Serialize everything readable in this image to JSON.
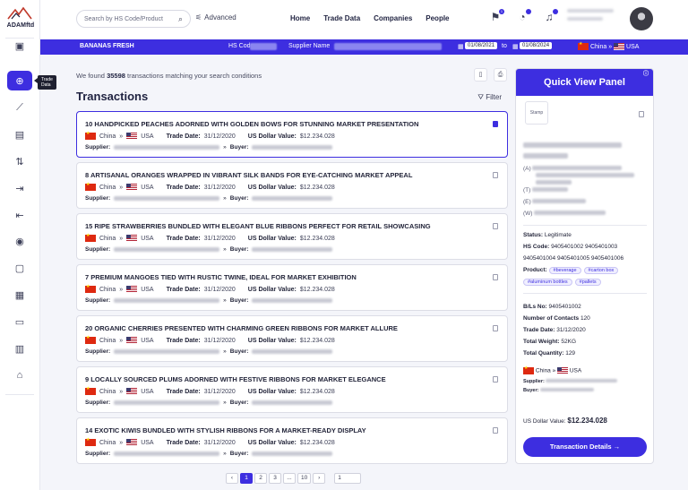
{
  "brand": {
    "name": "ADAMftd"
  },
  "sidebar": {
    "tooltip": "Trade Data",
    "icons": [
      "panel-icon",
      "search-trade-icon",
      "chart-icon",
      "document-dollar-icon",
      "exchange-icon",
      "export-icon",
      "import-icon",
      "location-icon",
      "briefcase-icon",
      "store-icon",
      "id-card-icon",
      "barcode-icon",
      "bank-icon"
    ]
  },
  "header": {
    "search_placeholder": "Search by HS Code/Product",
    "advanced_label": "Advanced",
    "nav": [
      "Home",
      "Trade Data",
      "Companies",
      "People"
    ],
    "notification_count": "1"
  },
  "filterbar": {
    "title": "BANANAS FRESH",
    "hs_label": "HS Code",
    "supplier_label": "Supplier Name",
    "date_from": "01/08/2021",
    "to_label": "to",
    "date_to": "01/08/2024",
    "origin": "China",
    "destination": "USA"
  },
  "results": {
    "prefix": "We found",
    "count": "35598",
    "suffix": "transactions matching your search conditions",
    "heading": "Transactions",
    "filter_label": "Filter"
  },
  "labels": {
    "trade_date": "Trade Date:",
    "usd_value": "US Dollar Value:",
    "supplier": "Supplier:",
    "buyer": "Buyer:",
    "origin": "China",
    "destination": "USA",
    "arrow": "»"
  },
  "transactions": [
    {
      "title": "10 HANDPICKED PEACHES ADORNED WITH GOLDEN BOWS FOR STUNNING MARKET PRESENTATION",
      "date": "31/12/2020",
      "value": "$12.234.028"
    },
    {
      "title": "8 ARTISANAL ORANGES WRAPPED IN VIBRANT SILK BANDS FOR EYE-CATCHING MARKET APPEAL",
      "date": "31/12/2020",
      "value": "$12.234.028"
    },
    {
      "title": "15 RIPE STRAWBERRIES BUNDLED WITH ELEGANT BLUE RIBBONS PERFECT FOR RETAIL SHOWCASING",
      "date": "31/12/2020",
      "value": "$12.234.028"
    },
    {
      "title": "7 PREMIUM MANGOES TIED WITH RUSTIC TWINE, IDEAL FOR MARKET EXHIBITION",
      "date": "31/12/2020",
      "value": "$12.234.028"
    },
    {
      "title": "20 ORGANIC CHERRIES PRESENTED WITH CHARMING GREEN RIBBONS FOR MARKET ALLURE",
      "date": "31/12/2020",
      "value": "$12.234.028"
    },
    {
      "title": "9 LOCALLY SOURCED PLUMS ADORNED WITH FESTIVE RIBBONS FOR MARKET ELEGANCE",
      "date": "31/12/2020",
      "value": "$12.234.028"
    },
    {
      "title": "14 EXOTIC KIWIS BUNDLED WITH STYLISH RIBBONS FOR A MARKET-READY DISPLAY",
      "date": "31/12/2020",
      "value": "$12.234.028"
    }
  ],
  "pagination": {
    "prev": "‹",
    "pages": [
      "1",
      "2",
      "3",
      "...",
      "10"
    ],
    "next": "›",
    "input_value": "1"
  },
  "quick_view": {
    "title": "Quick View Panel",
    "logo_text": "Stamp",
    "address_prefix": "(A)",
    "tel_prefix": "(T)",
    "email_prefix": "(E)",
    "web_prefix": "(W)",
    "status_label": "Status:",
    "status_value": "Legitimate",
    "hs_label": "HS Code:",
    "hs_codes_line1": "9405401002  9405401003",
    "hs_codes_line2": "9405401004  9405401005  9405401006",
    "product_label": "Product:",
    "products": [
      "#beverage",
      "#carton box",
      "#aluminum bottles",
      "#pallets"
    ],
    "bl_label": "B/Ls No:",
    "bl_value": "9405401002",
    "contacts_label": "Number of Contacts",
    "contacts_value": "120",
    "trade_date_label": "Trade Date:",
    "trade_date_value": "31/12/2020",
    "weight_label": "Total Weight:",
    "weight_value": "52KG",
    "quantity_label": "Total Quantity:",
    "quantity_value": "129",
    "origin": "China",
    "destination": "USA",
    "supplier_label": "Supplier:",
    "buyer_label": "Buyer:",
    "usd_label": "US Dollar Value:",
    "usd_value": "$12.234.028",
    "button_label": "Transaction Details  →"
  }
}
